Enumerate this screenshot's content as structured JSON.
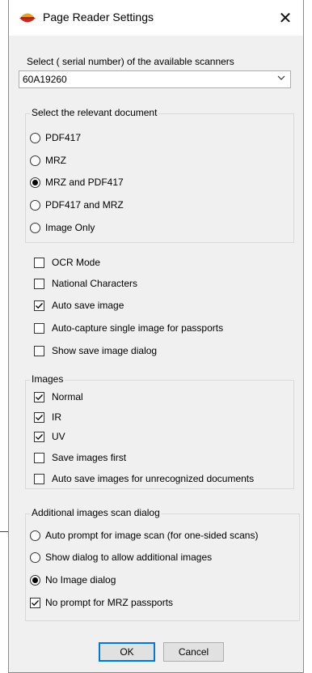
{
  "window": {
    "title": "Page Reader Settings",
    "close_glyph": "✕",
    "icon": "app-logo-icon"
  },
  "scanner": {
    "label": "Select ( serial number) of  the available scanners",
    "selected": "60A19260"
  },
  "document_group": {
    "title": "Select the relevant document",
    "options": [
      {
        "label": "PDF417",
        "checked": false
      },
      {
        "label": "MRZ",
        "checked": false
      },
      {
        "label": "MRZ and PDF417",
        "checked": true
      },
      {
        "label": "PDF417 and MRZ",
        "checked": false
      },
      {
        "label": "Image Only",
        "checked": false
      }
    ]
  },
  "options": [
    {
      "label": "OCR Mode",
      "checked": false
    },
    {
      "label": "National Characters",
      "checked": false
    },
    {
      "label": "Auto save image",
      "checked": true
    },
    {
      "label": "Auto-capture single image for passports",
      "checked": false
    },
    {
      "label": "Show save image dialog",
      "checked": false
    }
  ],
  "images_group": {
    "title": "Images",
    "options": [
      {
        "label": "Normal",
        "checked": true
      },
      {
        "label": "IR",
        "checked": true
      },
      {
        "label": "UV",
        "checked": true
      },
      {
        "label": "Save images first",
        "checked": false
      },
      {
        "label": "Auto save images for unrecognized documents",
        "checked": false
      }
    ]
  },
  "additional_group": {
    "title": "Additional images scan dialog",
    "radios": [
      {
        "label": "Auto prompt for image scan (for one-sided scans)",
        "checked": false
      },
      {
        "label": "Show dialog to allow additional images",
        "checked": false
      },
      {
        "label": "No Image dialog",
        "checked": true
      }
    ],
    "checkbox": {
      "label": "No prompt for MRZ passports",
      "checked": true
    }
  },
  "buttons": {
    "ok": "OK",
    "cancel": "Cancel"
  },
  "colors": {
    "dialog_bg": "#f0f0f0",
    "default_button_border": "#0078d7"
  }
}
